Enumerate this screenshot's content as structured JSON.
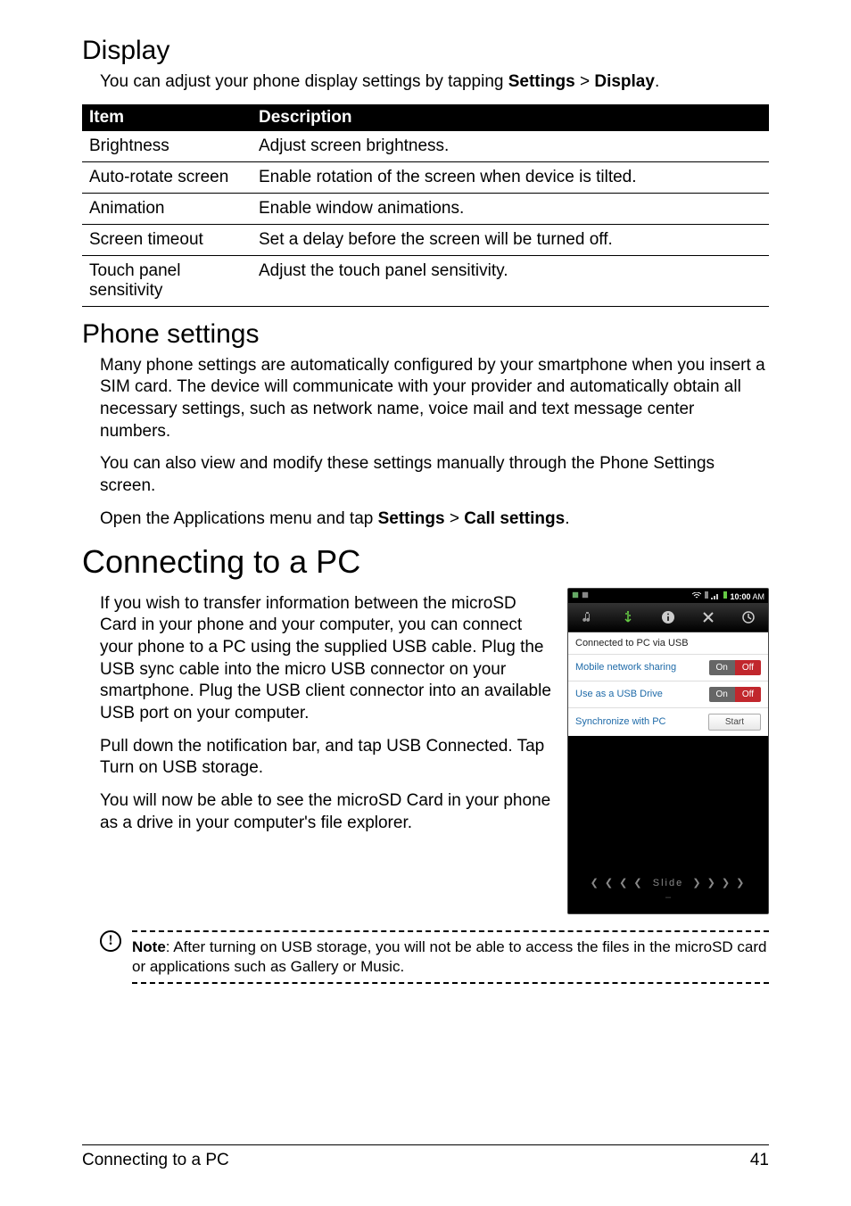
{
  "section_display_title": "Display",
  "display_intro_prefix": "You can adjust your phone display settings by tapping ",
  "display_intro_b1": "Settings",
  "display_intro_mid": " > ",
  "display_intro_b2": "Display",
  "display_intro_suffix": ".",
  "table_headers": {
    "col1": "Item",
    "col2": "Description"
  },
  "table_rows": [
    {
      "item": "Brightness",
      "desc": "Adjust screen brightness."
    },
    {
      "item": "Auto-rotate screen",
      "desc": "Enable rotation of the screen when device is tilted."
    },
    {
      "item": "Animation",
      "desc": "Enable window animations."
    },
    {
      "item": "Screen timeout",
      "desc": "Set a delay before the screen will be turned off."
    },
    {
      "item": "Touch panel sensitivity",
      "desc": "Adjust the touch panel sensitivity."
    }
  ],
  "section_phone_title": "Phone settings",
  "phone_p1": "Many phone settings are automatically configured by your smartphone when you insert a SIM card. The device will communicate with your provider and automatically obtain all necessary settings, such as network name, voice mail and text message center numbers.",
  "phone_p2": "You can also view and modify these settings manually through the Phone Settings screen.",
  "phone_p3_prefix": "Open the Applications menu and tap ",
  "phone_p3_b1": "Settings",
  "phone_p3_mid": " > ",
  "phone_p3_b2": "Call settings",
  "phone_p3_suffix": ".",
  "section_connect_title": "Connecting to a PC",
  "connect_p1": "If you wish to transfer information between the microSD Card in your phone and your computer, you can connect your phone to a PC using the supplied USB cable. Plug the USB sync cable into the micro USB connector on your smartphone. Plug the USB client connector into an available USB port on your computer.",
  "connect_p2_prefix": "Pull down the notification bar, and tap ",
  "connect_p2_b1": "USB Connected",
  "connect_p2_mid": ". Tap ",
  "connect_p2_b2": "Turn on USB storage.",
  "connect_p3": "You will now be able to see the microSD Card in your phone as a drive in your computer's file explorer.",
  "note_label": "Note",
  "note_text": ": After turning on USB storage, you will not be able to access the files in the microSD card or applications such as Gallery or Music.",
  "footer_left": "Connecting to a PC",
  "footer_right": "41",
  "screenshot": {
    "time": "10:00",
    "time_suffix": " AM",
    "panel_heading": "Connected to PC via USB",
    "row1_label": "Mobile network sharing",
    "row2_label": "Use as a USB Drive",
    "row3_label": "Synchronize with PC",
    "on": "On",
    "off": "Off",
    "start": "Start",
    "slide": "Slide"
  }
}
